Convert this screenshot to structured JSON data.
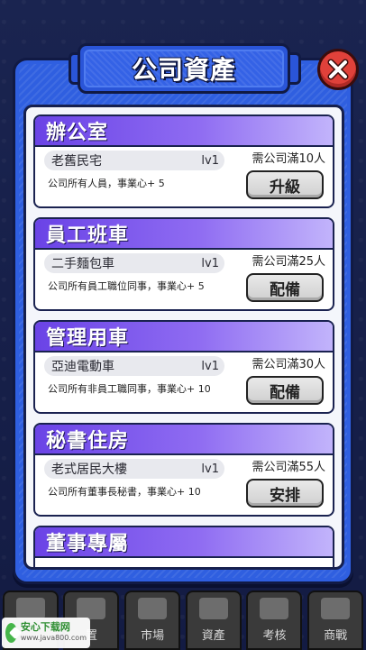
{
  "title": "公司資產",
  "cards": [
    {
      "title": "辦公室",
      "item": "老舊民宅",
      "level": "lv1",
      "effect": "公司所有人員，事業心+ 5",
      "requirement": "需公司滿10人",
      "button": "升級"
    },
    {
      "title": "員工班車",
      "item": "二手麵包車",
      "level": "lv1",
      "effect": "公司所有員工職位同事，事業心+ 5",
      "requirement": "需公司滿25人",
      "button": "配備"
    },
    {
      "title": "管理用車",
      "item": "亞迪電動車",
      "level": "lv1",
      "effect": "公司所有非員工職同事，事業心+ 10",
      "requirement": "需公司滿30人",
      "button": "配備"
    },
    {
      "title": "秘書住房",
      "item": "老式居民大樓",
      "level": "lv1",
      "effect": "公司所有董事長秘書，事業心+ 10",
      "requirement": "需公司滿55人",
      "button": "安排"
    },
    {
      "title": "董事專屬",
      "item": "",
      "level": "",
      "effect": "",
      "requirement": "",
      "button": ""
    }
  ],
  "bottom_nav": [
    {
      "label": "",
      "icon": "person-icon"
    },
    {
      "label": "置",
      "icon": "printer-icon"
    },
    {
      "label": "市場",
      "icon": "market-icon"
    },
    {
      "label": "資產",
      "icon": "chart-icon"
    },
    {
      "label": "考核",
      "icon": "clipboard-icon"
    },
    {
      "label": "商戰",
      "icon": "briefcase-icon"
    }
  ],
  "watermark": {
    "main": "安心下载网",
    "url": "www.java800.com"
  }
}
